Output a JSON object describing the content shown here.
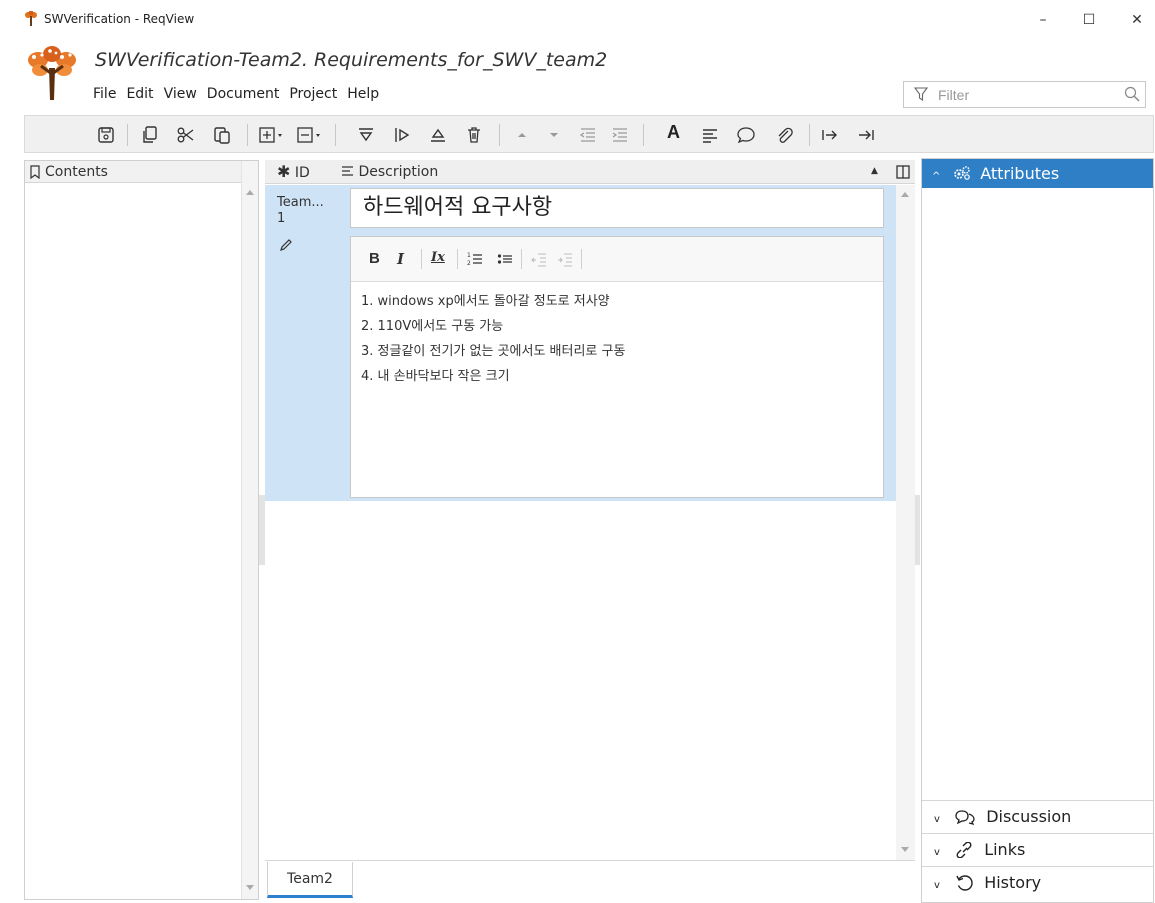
{
  "window": {
    "title": "SWVerification - ReqView",
    "minimize": "–",
    "maximize": "☐",
    "close": "✕"
  },
  "document_title": "SWVerification-Team2. Requirements_for_SWV_team2",
  "menu": [
    "File",
    "Edit",
    "View",
    "Document",
    "Project",
    "Help"
  ],
  "filter": {
    "placeholder": "Filter"
  },
  "toolbar": {
    "text_style": "A"
  },
  "contents": {
    "header": "Contents"
  },
  "table": {
    "col_id": "ID",
    "col_description": "Description",
    "row": {
      "id_line1": "Team...",
      "id_line2": "1",
      "heading": "하드웨어적 요구사항",
      "lines": [
        "1. windows xp에서도 돌아갈 정도로 저사양",
        "2. 110V에서도 구동 가능",
        "3. 정글같이 전기가 없는 곳에서도 배터리로 구동",
        "4. 내 손바닥보다 작은 크기"
      ]
    }
  },
  "editor_toolbar": {
    "bold": "B",
    "italic": "I",
    "clear": "Ix"
  },
  "tabs": {
    "team2": "Team2"
  },
  "right_panel": {
    "attributes": "Attributes",
    "discussion": "Discussion",
    "links": "Links",
    "history": "History"
  },
  "colors": {
    "accent": "#2f7fc6",
    "row_selected": "#cfe3f7"
  }
}
